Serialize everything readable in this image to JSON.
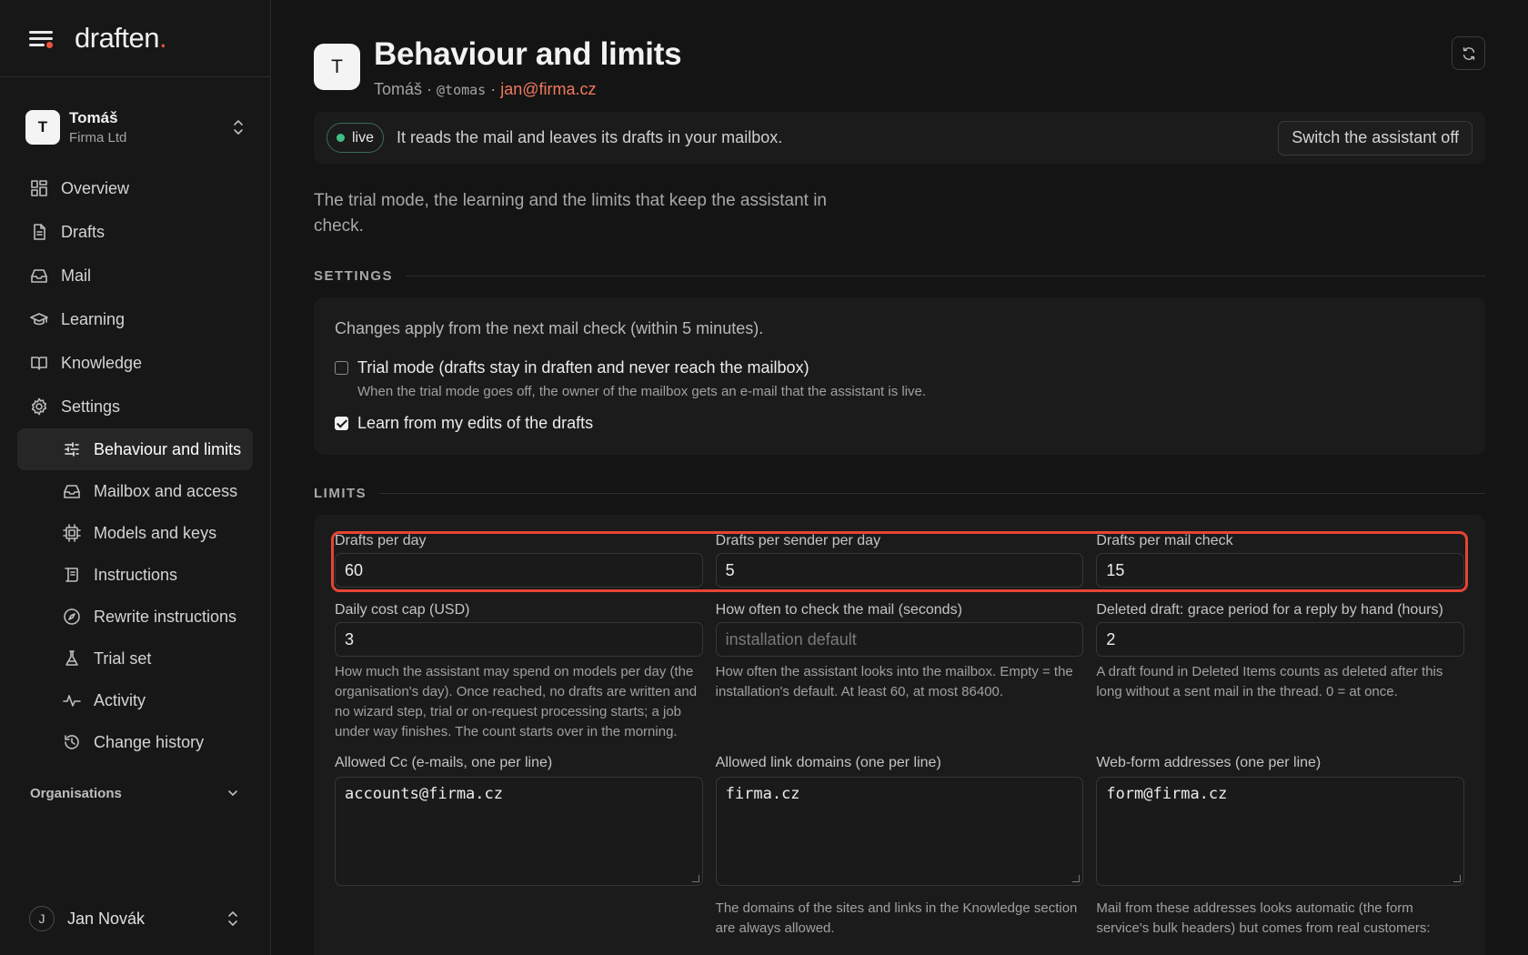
{
  "app": {
    "logo": "draften",
    "logo_dot": "."
  },
  "org": {
    "initial": "T",
    "name": "Tomáš",
    "company": "Firma Ltd"
  },
  "nav": {
    "overview": "Overview",
    "drafts": "Drafts",
    "mail": "Mail",
    "learning": "Learning",
    "knowledge": "Knowledge",
    "settings": "Settings",
    "sub": {
      "behaviour": "Behaviour and limits",
      "mailbox": "Mailbox and access",
      "models": "Models and keys",
      "instructions": "Instructions",
      "rewrite": "Rewrite instructions",
      "trial": "Trial set",
      "activity": "Activity",
      "history": "Change history"
    },
    "organisations": "Organisations"
  },
  "user": {
    "initial": "J",
    "name": "Jan Novák"
  },
  "header": {
    "initial": "T",
    "title": "Behaviour and limits",
    "name": "Tomáš",
    "sep": " · ",
    "handle": "@tomas",
    "email": "jan@firma.cz"
  },
  "status": {
    "badge": "live",
    "text": "It reads the mail and leaves its drafts in your mailbox.",
    "switch_off": "Switch the assistant off"
  },
  "intro": "The trial mode, the learning and the limits that keep the assistant in check.",
  "settings": {
    "label": "SETTINGS",
    "note": "Changes apply from the next mail check (within 5 minutes).",
    "trial_mode": {
      "label": "Trial mode (drafts stay in draften and never reach the mailbox)",
      "help": "When the trial mode goes off, the owner of the mailbox gets an e-mail that the assistant is live.",
      "checked": false
    },
    "learn": {
      "label": "Learn from my edits of the drafts",
      "checked": true
    }
  },
  "limits": {
    "label": "LIMITS",
    "drafts_per_day": {
      "label": "Drafts per day",
      "value": "60"
    },
    "drafts_per_sender": {
      "label": "Drafts per sender per day",
      "value": "5"
    },
    "drafts_per_check": {
      "label": "Drafts per mail check",
      "value": "15"
    },
    "cost_cap": {
      "label": "Daily cost cap (USD)",
      "value": "3",
      "help": "How much the assistant may spend on models per day (the organisation's day). Once reached, no drafts are written and no wizard step, trial or on-request processing starts; a job under way finishes. The count starts over in the morning."
    },
    "check_interval": {
      "label": "How often to check the mail (seconds)",
      "placeholder": "installation default",
      "help": "How often the assistant looks into the mailbox. Empty = the installation's default. At least 60, at most 86400."
    },
    "grace": {
      "label": "Deleted draft: grace period for a reply by hand (hours)",
      "value": "2",
      "help": "A draft found in Deleted Items counts as deleted after this long without a sent mail in the thread. 0 = at once."
    },
    "allowed_cc": {
      "label": "Allowed Cc (e-mails, one per line)",
      "value": "accounts@firma.cz"
    },
    "link_domains": {
      "label": "Allowed link domains (one per line)",
      "value": "firma.cz",
      "help": "The domains of the sites and links in the Knowledge section are always allowed."
    },
    "webform": {
      "label": "Web-form addresses (one per line)",
      "value": "form@firma.cz",
      "help": "Mail from these addresses looks automatic (the form service's bulk headers) but comes from real customers:"
    }
  },
  "colors": {
    "accent": "#f0533d",
    "live": "#3fbf85",
    "highlight": "#e64532",
    "email": "#f07a5e"
  }
}
